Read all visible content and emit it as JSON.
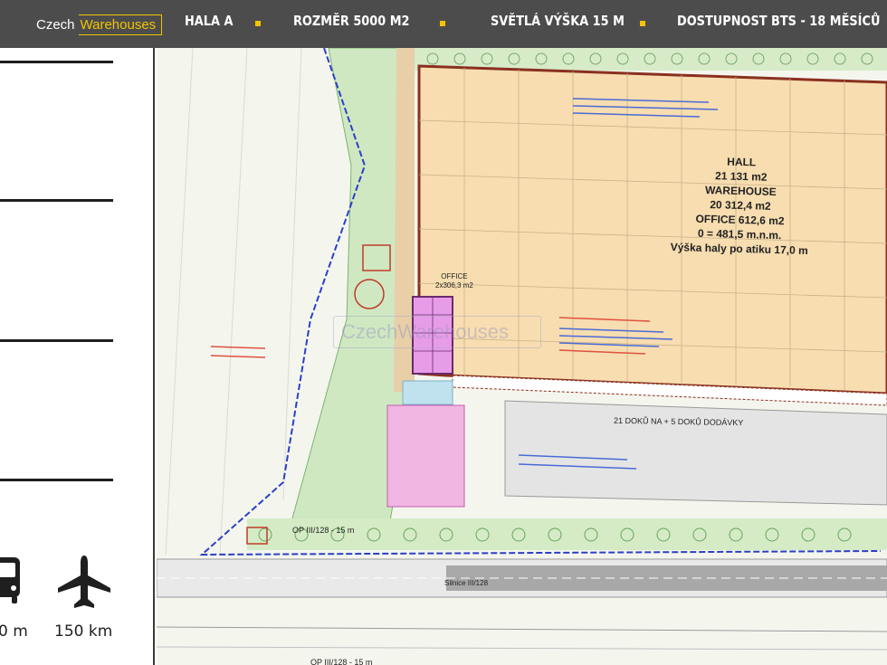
{
  "header": {
    "logo": {
      "word1": "Czech",
      "word2": "Warehouses"
    },
    "nav": [
      {
        "label": "HALA A"
      },
      {
        "label": "ROZMĚR 5000 M2"
      },
      {
        "label": "SVĚTLÁ VÝŠKA  15 M"
      },
      {
        "label": "DOSTUPNOST BTS - 18 MĚSÍCŮ"
      }
    ],
    "accent_color": "#f2c400"
  },
  "sidebar": {
    "distances": [
      {
        "icon": "bus-icon",
        "value": "0 m"
      },
      {
        "icon": "plane-icon",
        "value": "150 km"
      }
    ]
  },
  "site_plan": {
    "hall_label": [
      "HALL",
      "21 131 m2",
      "WAREHOUSE",
      "20 312,4 m2",
      "OFFICE 612,6 m2",
      "0 = 481,5 m.n.m.",
      "Výška haly po atiku 17,0 m"
    ],
    "office_label": [
      "OFFICE",
      "2x306,3 m2"
    ],
    "dock_label": "21 DOKŮ NA + 5 DOKŮ DODÁVKY",
    "op_label": "OP III/128 - 15 m",
    "op_label_2": "OP III/128 - 15 m",
    "road_label": "Silnice III/128",
    "watermark": "CzechWarehouses"
  }
}
